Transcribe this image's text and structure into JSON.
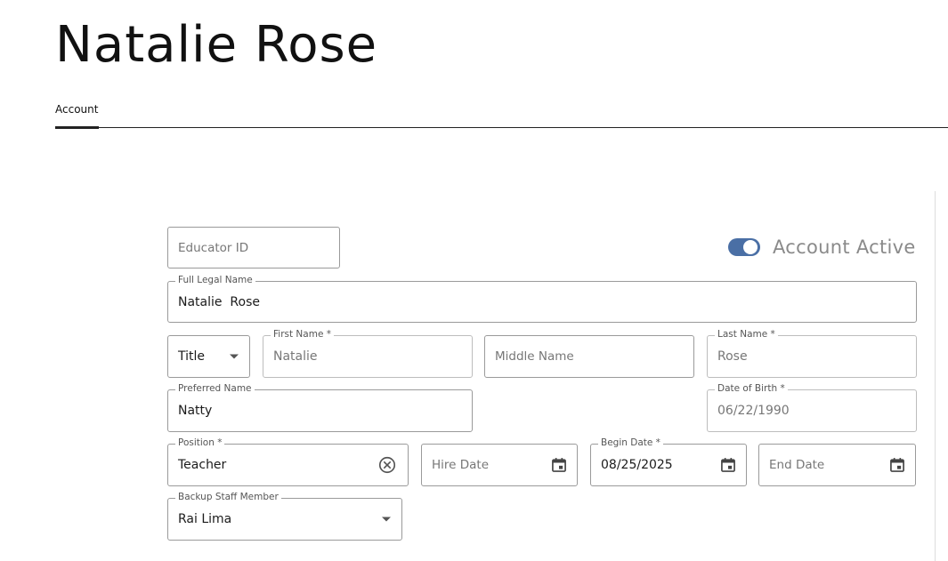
{
  "header": {
    "title": "Natalie Rose",
    "corner_mark": "”"
  },
  "tabs": [
    {
      "label": "Account",
      "active": true
    }
  ],
  "form": {
    "educator_id": {
      "placeholder": "Educator ID",
      "value": ""
    },
    "account_active": {
      "label": "Account Active",
      "on": true
    },
    "full_legal_name": {
      "label": "Full Legal Name",
      "value": "Natalie  Rose"
    },
    "title": {
      "value": "Title",
      "icon": "caret-down-icon"
    },
    "first_name": {
      "label": "First Name *",
      "value": "Natalie"
    },
    "middle_name": {
      "placeholder": "Middle Name",
      "value": ""
    },
    "last_name": {
      "label": "Last Name *",
      "value": "Rose"
    },
    "preferred_name": {
      "label": "Preferred Name",
      "value": "Natty"
    },
    "date_of_birth": {
      "label": "Date of Birth *",
      "value": "06/22/1990"
    },
    "position": {
      "label": "Position *",
      "value": "Teacher",
      "icon": "clear-icon"
    },
    "hire_date": {
      "placeholder": "Hire Date",
      "value": "",
      "icon": "calendar-icon"
    },
    "begin_date": {
      "label": "Begin Date *",
      "value": "08/25/2025",
      "icon": "calendar-icon"
    },
    "end_date": {
      "placeholder": "End Date",
      "value": "",
      "icon": "calendar-icon"
    },
    "backup_staff": {
      "label": "Backup Staff Member",
      "value": "Rai Lima",
      "icon": "caret-down-icon"
    }
  },
  "colors": {
    "accent": "#4a6fa5",
    "border": "#9a9a9a",
    "muted_text": "#777777"
  }
}
